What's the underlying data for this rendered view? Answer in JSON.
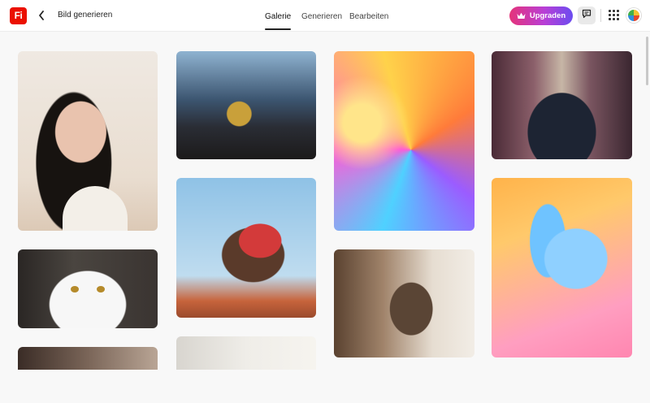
{
  "app": {
    "logo_text": "Fi",
    "page_title": "Bild generieren",
    "brand_color": "#eb1000"
  },
  "tabs": [
    {
      "label": "Galerie",
      "active": true
    },
    {
      "label": "Generieren",
      "active": false
    },
    {
      "label": "Bearbeiten",
      "active": false
    }
  ],
  "header": {
    "upgrade_label": "Upgraden",
    "upgrade_icon": "crown-icon",
    "feedback_icon": "chat-icon",
    "apps_icon": "grid-icon"
  },
  "gallery": {
    "items": [
      {
        "subject": "portrait-woman"
      },
      {
        "subject": "lighthouse-interior"
      },
      {
        "subject": "abstract-glass-swirl"
      },
      {
        "subject": "two-men-neon-street"
      },
      {
        "subject": "sprinter-start-blocks"
      },
      {
        "subject": "glass-bird"
      },
      {
        "subject": "white-cat"
      },
      {
        "subject": "woman-painting"
      },
      {
        "subject": "interior-room"
      },
      {
        "subject": "kitchen-counter"
      }
    ]
  }
}
